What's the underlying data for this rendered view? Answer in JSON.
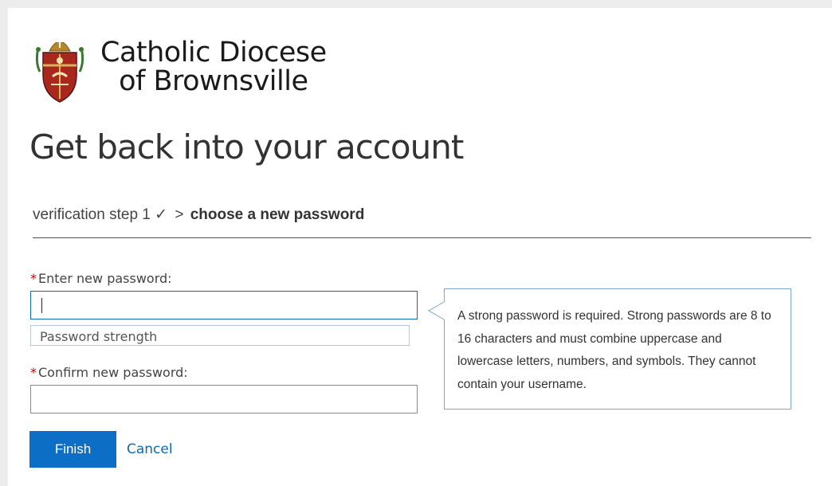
{
  "org": {
    "line1": "Catholic Diocese",
    "line2": "of Brownsville",
    "crest_icon": "diocese-crest-icon"
  },
  "page_title": "Get back into your account",
  "steps": {
    "completed": "verification step 1",
    "completed_mark": "✓",
    "separator": ">",
    "current": "choose a new password"
  },
  "form": {
    "required_mark": "*",
    "new_password": {
      "label": "Enter new password:",
      "value": ""
    },
    "strength_label": "Password strength",
    "confirm_password": {
      "label": "Confirm new password:",
      "value": ""
    }
  },
  "tooltip": {
    "text": "A strong password is required. Strong passwords are 8 to 16 characters and must combine uppercase and lowercase letters, numbers, and symbols. They cannot contain your username."
  },
  "actions": {
    "finish_label": "Finish",
    "cancel_label": "Cancel"
  },
  "colors": {
    "accent": "#0d6ec6",
    "focus_border": "#0a6ab8",
    "required": "#c00000"
  }
}
